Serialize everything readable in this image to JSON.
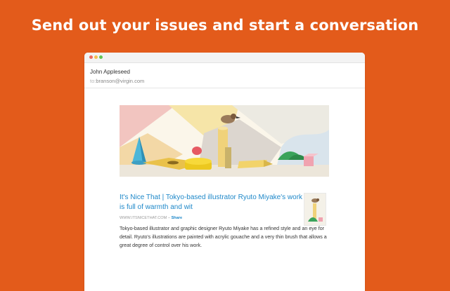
{
  "headline": "Send out your issues and start a conversation",
  "email": {
    "from_name": "John Appleseed",
    "to_label": "to:",
    "to_address": "branson@virgin.com"
  },
  "article": {
    "title": "It's Nice That | Tokyo-based illustrator Ryuto Miyake's work is full of warmth and wit",
    "source": "WWW.ITSNICETHAT.COM",
    "separator": "–",
    "share_label": "Share",
    "body": "Tokyo-based illustrator and graphic designer Ryuto Miyake has a refined style and an eye for detail. Ryuto's illustrations are painted with acrylic gouache and a very thin brush that allows a great degree of control over his work."
  },
  "colors": {
    "background": "#e35b1b",
    "link": "#1e88c9"
  }
}
